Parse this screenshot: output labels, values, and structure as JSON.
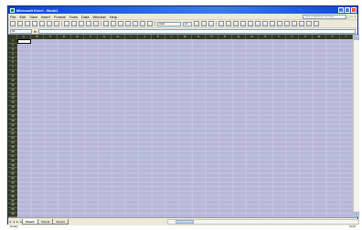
{
  "window": {
    "title": "Microsoft Excel - Book1"
  },
  "window_controls": {
    "minimize": "_",
    "restore": "□",
    "close": "×"
  },
  "menu": {
    "items": [
      "File",
      "Edit",
      "View",
      "Insert",
      "Format",
      "Tools",
      "Data",
      "Window",
      "Help"
    ]
  },
  "help": {
    "placeholder": "Type a question for help"
  },
  "toolbar": {
    "font_name": "Arial",
    "font_size": "10"
  },
  "formula_bar": {
    "cell_ref": "A1",
    "fx": "fx",
    "value": ""
  },
  "grid": {
    "columns": [
      "A",
      "B",
      "C",
      "D",
      "E",
      "F",
      "G",
      "H",
      "I",
      "J",
      "K",
      "L",
      "M",
      "N",
      "O",
      "P",
      "Q",
      "R",
      "S",
      "T",
      "U",
      "V",
      "W",
      "X",
      "Y"
    ],
    "rows": [
      "1",
      "2",
      "3",
      "4",
      "5",
      "6",
      "7",
      "8",
      "9",
      "10",
      "11",
      "12",
      "13",
      "14",
      "15",
      "16",
      "17",
      "18",
      "19",
      "20",
      "21",
      "22",
      "23",
      "24",
      "25",
      "26",
      "27",
      "28",
      "29",
      "30",
      "31",
      "32",
      "33",
      "34",
      "35",
      "36",
      "37",
      "38",
      "39",
      "40"
    ],
    "active_cell": "A1"
  },
  "sheets": {
    "tabs": [
      "Sheet1",
      "Sheet2",
      "Sheet3"
    ],
    "active": "Sheet1"
  },
  "status": {
    "left": "Ready",
    "right": "NUM"
  },
  "colors": {
    "title_bar": "#0a46d8",
    "header_bg": "#333a28",
    "cell_bg": "#b4b7d8"
  }
}
